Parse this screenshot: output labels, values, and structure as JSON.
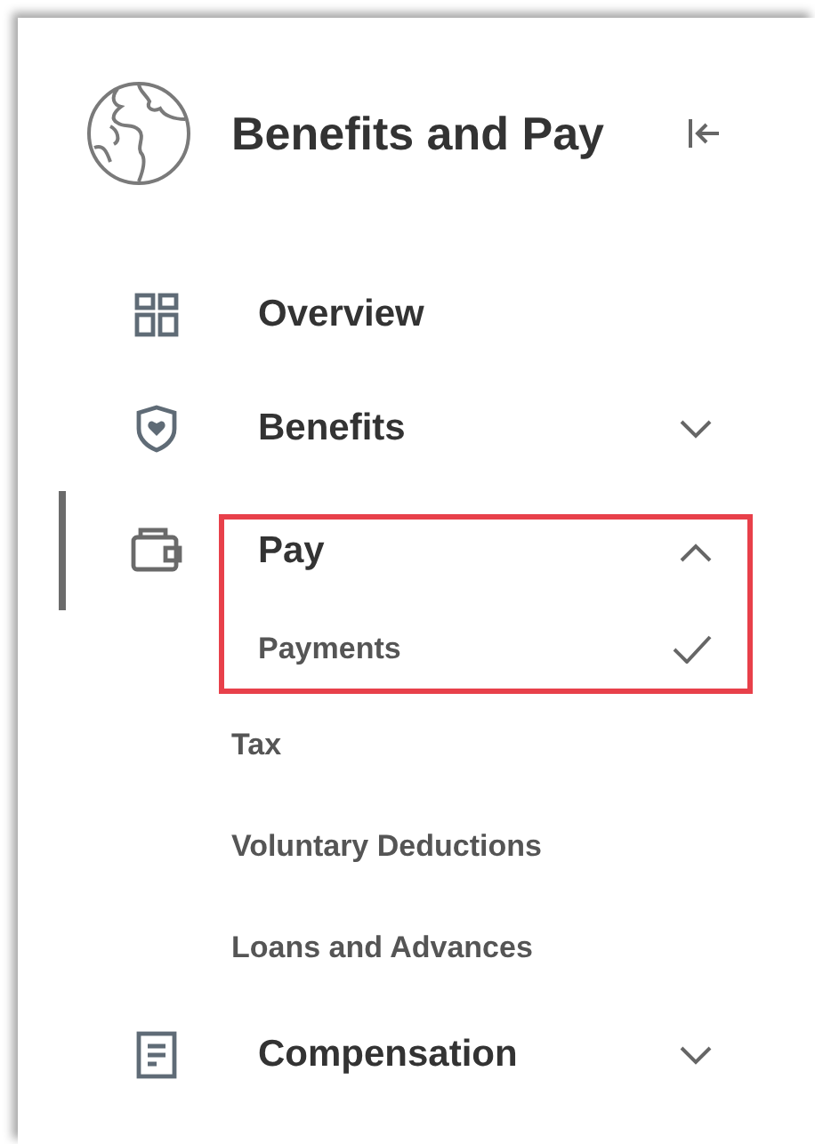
{
  "header": {
    "title": "Benefits and Pay"
  },
  "nav": [
    {
      "kind": "grid",
      "label": "Overview",
      "selected": false,
      "highlighted": false
    },
    {
      "kind": "shield",
      "label": "Benefits",
      "selected": false,
      "expanded": false,
      "highlighted": false
    },
    {
      "kind": "wallet",
      "label": "Pay",
      "selected": true,
      "expanded": true,
      "highlighted": true,
      "children": [
        {
          "label": "Payments",
          "selected": true
        },
        {
          "label": "Tax",
          "selected": false
        },
        {
          "label": "Voluntary Deductions",
          "selected": false
        },
        {
          "label": "Loans and Advances",
          "selected": false
        }
      ]
    },
    {
      "kind": "doc",
      "label": "Compensation",
      "selected": false,
      "expanded": false,
      "highlighted": false
    }
  ]
}
